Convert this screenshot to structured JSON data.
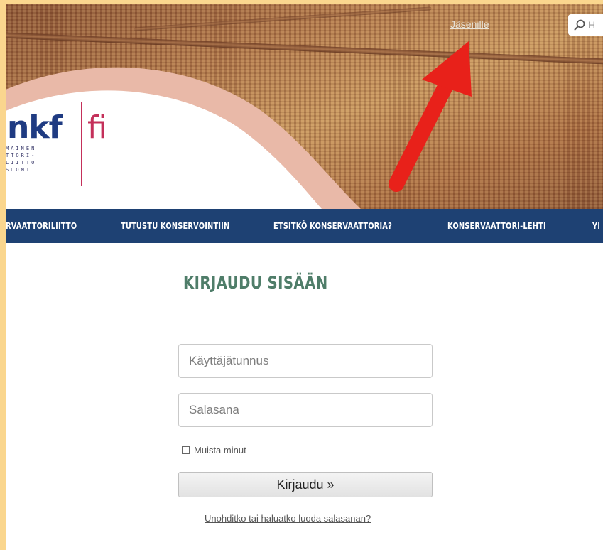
{
  "header": {
    "member_link": "Jäsenille",
    "search_placeholder": "H",
    "logo": {
      "main": "nkf",
      "suffix": "fi",
      "small_lines": [
        "MAINEN",
        "TTORI-",
        "LIITTO",
        "SUOMI"
      ]
    }
  },
  "nav": {
    "items": [
      {
        "label": "RVAATTORILIITTO"
      },
      {
        "label": "TUTUSTU KONSERVOINTIIN"
      },
      {
        "label": "ETSITKÖ KONSERVAATTORIA?"
      },
      {
        "label": "KONSERVAATTORI-LEHTI"
      },
      {
        "label": "YI"
      }
    ]
  },
  "login": {
    "title": "KIRJAUDU SISÄÄN",
    "username_placeholder": "Käyttäjätunnus",
    "password_placeholder": "Salasana",
    "remember_label": "Muista minut",
    "submit_label": "Kirjaudu »",
    "forgot_link": "Unohditko tai haluatko luoda salasanan?"
  },
  "colors": {
    "page_border": "#fad68e",
    "nav_bg": "#1e4173",
    "title_green": "#4f7d69",
    "logo_blue": "#1f3b82",
    "logo_red": "#c4305a",
    "arrow_red": "#e8211a"
  }
}
